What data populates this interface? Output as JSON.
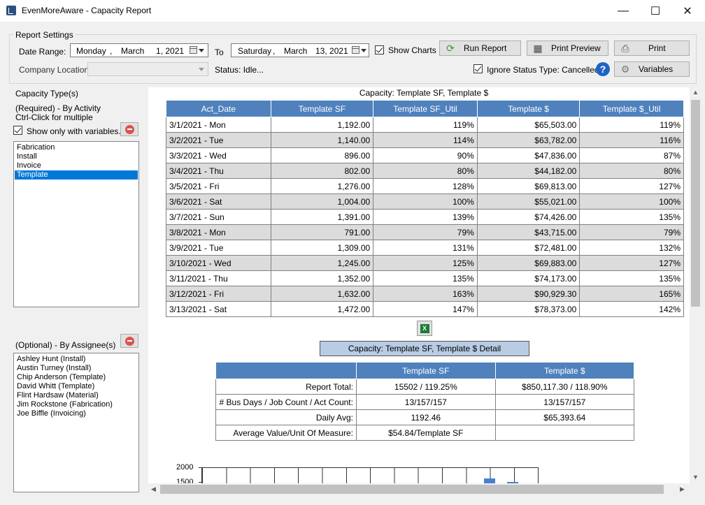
{
  "window": {
    "title": "EvenMoreAware - Capacity Report",
    "minimize": "—",
    "maximize": "☐",
    "close": "✕"
  },
  "settings": {
    "group_label": "Report Settings",
    "date_range_label": "Date Range:",
    "from_weekday": "Monday",
    "from_sep": ",",
    "from_month": "March",
    "from_daypart": "1, 2021",
    "to_label": "To",
    "to_weekday": "Saturday",
    "to_sep": ",",
    "to_month": "March",
    "to_daypart": "13, 2021",
    "show_charts_label": "Show Charts",
    "show_charts_checked": true,
    "company_location_label": "Company Location",
    "company_location_value": "",
    "status_text": "Status: Idle...",
    "ignore_status_label": "Ignore Status Type: Cancelled",
    "ignore_status_checked": true,
    "run_report": "Run Report",
    "print_preview": "Print Preview",
    "print": "Print",
    "variables": "Variables",
    "help": "?"
  },
  "left_panel": {
    "capacity_types_label": "Capacity Type(s)",
    "required_label": "(Required) - By Activity",
    "ctrl_click_label": "Ctrl-Click for multiple",
    "show_only_vars_label": "Show only with variables.",
    "show_only_vars_checked": true,
    "activities": [
      "Fabrication",
      "Install",
      "Invoice",
      "Template"
    ],
    "selected_activity": "Template",
    "optional_label": "(Optional) - By Assignee(s)",
    "assignees": [
      "Ashley Hunt (Install)",
      "Austin Turney (Install)",
      "Chip Anderson (Template)",
      "David Whitt (Template)",
      "Flint Hardsaw (Material)",
      "Jim Rockstone (Fabrication)",
      "Joe Biffle (Invoicing)"
    ]
  },
  "report": {
    "main_title": "Capacity: Template SF, Template $",
    "columns": [
      "Act_Date",
      "Template SF",
      "Template SF_Util",
      "Template $",
      "Template $_Util"
    ],
    "rows": [
      [
        "3/1/2021 - Mon",
        "1,192.00",
        "119%",
        "$65,503.00",
        "119%"
      ],
      [
        "3/2/2021 - Tue",
        "1,140.00",
        "114%",
        "$63,782.00",
        "116%"
      ],
      [
        "3/3/2021 - Wed",
        "896.00",
        "90%",
        "$47,836.00",
        "87%"
      ],
      [
        "3/4/2021 - Thu",
        "802.00",
        "80%",
        "$44,182.00",
        "80%"
      ],
      [
        "3/5/2021 - Fri",
        "1,276.00",
        "128%",
        "$69,813.00",
        "127%"
      ],
      [
        "3/6/2021 - Sat",
        "1,004.00",
        "100%",
        "$55,021.00",
        "100%"
      ],
      [
        "3/7/2021 - Sun",
        "1,391.00",
        "139%",
        "$74,426.00",
        "135%"
      ],
      [
        "3/8/2021 - Mon",
        "791.00",
        "79%",
        "$43,715.00",
        "79%"
      ],
      [
        "3/9/2021 - Tue",
        "1,309.00",
        "131%",
        "$72,481.00",
        "132%"
      ],
      [
        "3/10/2021 - Wed",
        "1,245.00",
        "125%",
        "$69,883.00",
        "127%"
      ],
      [
        "3/11/2021 - Thu",
        "1,352.00",
        "135%",
        "$74,173.00",
        "135%"
      ],
      [
        "3/12/2021 - Fri",
        "1,632.00",
        "163%",
        "$90,929.30",
        "165%"
      ],
      [
        "3/13/2021 - Sat",
        "1,472.00",
        "147%",
        "$78,373.00",
        "142%"
      ]
    ],
    "detail_title": "Capacity: Template SF, Template $ Detail",
    "detail_columns": [
      "",
      "Template SF",
      "Template $"
    ],
    "detail_rows": [
      [
        "Report Total:",
        "15502 / 119.25%",
        "$850,117.30 / 118.90%"
      ],
      [
        "# Bus Days / Job Count / Act Count:",
        "13/157/157",
        "13/157/157"
      ],
      [
        "Daily Avg:",
        "1192.46",
        "$65,393.64"
      ],
      [
        "Average Value/Unit Of Measure:",
        "$54.84/Template SF",
        ""
      ]
    ],
    "chart_axis_labels": [
      "2000",
      "1500"
    ]
  },
  "colors": {
    "header_blue": "#4f81bd",
    "alt_row": "#dcdcdc",
    "selection": "#0078d7",
    "detail_title_bg": "#b8cce4"
  }
}
